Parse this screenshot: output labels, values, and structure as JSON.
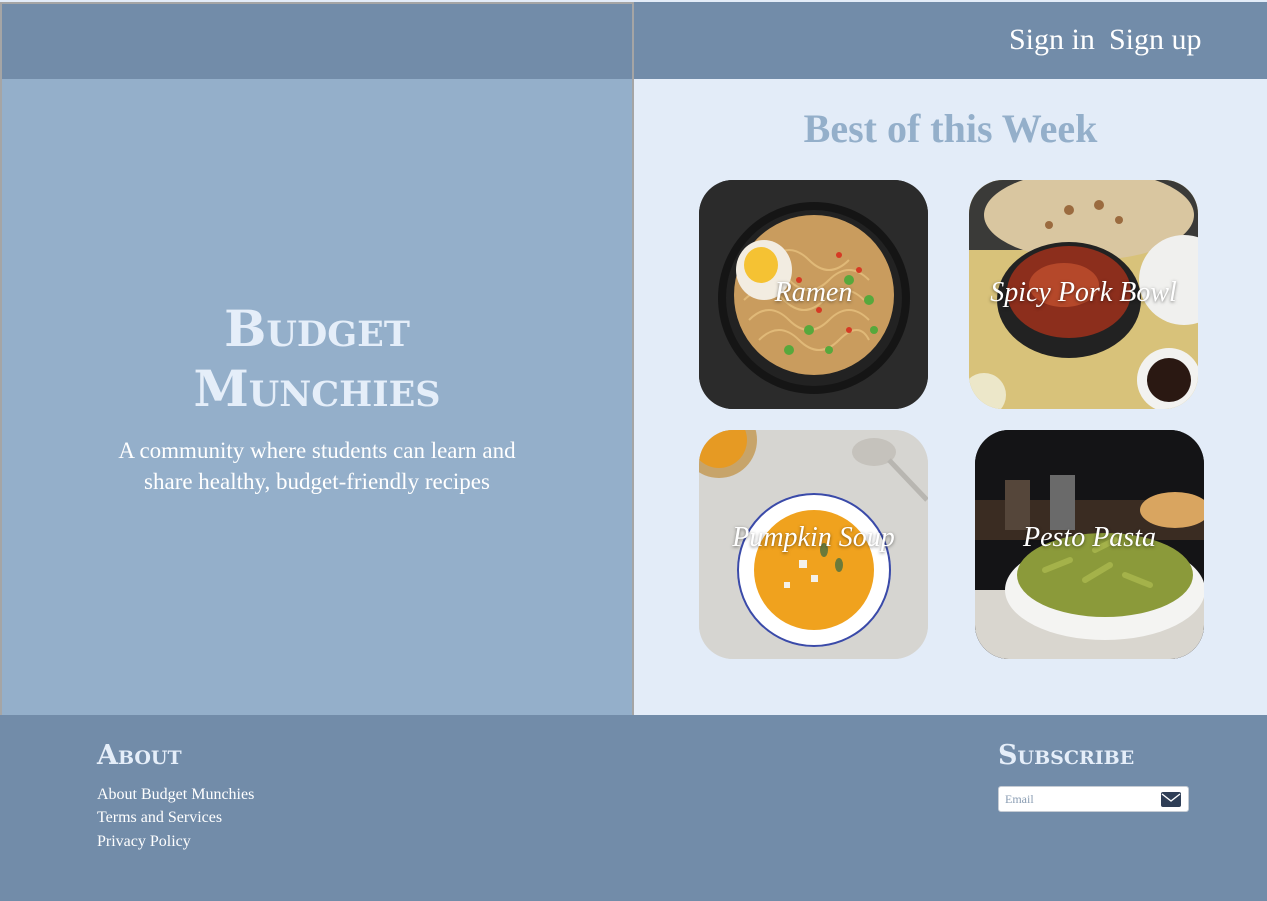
{
  "header": {
    "sign_in": "Sign in",
    "sign_up": "Sign up"
  },
  "hero": {
    "title_line1": "Budget",
    "title_line2": "Munchies",
    "tagline": "A community where students can learn and share healthy, budget-friendly recipes"
  },
  "best_of_week": {
    "title": "Best of this Week",
    "cards": [
      {
        "label": "Ramen",
        "image": "ramen-bowl-photo"
      },
      {
        "label": "Spicy Pork Bowl",
        "image": "pork-bowl-photo"
      },
      {
        "label": "Pumpkin Soup",
        "image": "pumpkin-soup-photo"
      },
      {
        "label": "Pesto Pasta",
        "image": "pesto-pasta-photo"
      }
    ]
  },
  "footer": {
    "about": {
      "heading": "About",
      "links": [
        "About Budget Munchies",
        "Terms and Services",
        "Privacy Policy"
      ]
    },
    "subscribe": {
      "heading": "Subscribe",
      "email_placeholder": "Email",
      "submit_icon": "envelope-icon"
    }
  },
  "colors": {
    "header_bg": "#728ca9",
    "left_panel_bg": "#94afca",
    "right_bg": "#e3ecf8",
    "accent_title": "#94afca",
    "hero_text": "#e5eef9"
  }
}
